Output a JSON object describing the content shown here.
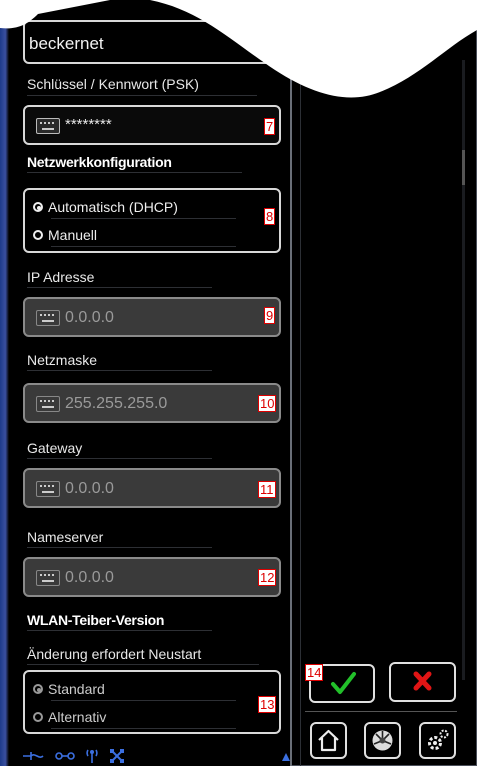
{
  "ssid": {
    "value": "beckernet"
  },
  "psk": {
    "label": "Schlüssel / Kennwort (PSK)",
    "value": "********",
    "badge": "7"
  },
  "netconfig": {
    "heading": "Netzwerkkonfiguration",
    "options": [
      "Automatisch (DHCP)",
      "Manuell"
    ],
    "selected": 0,
    "badge": "8"
  },
  "ip": {
    "label": "IP Adresse",
    "value": "0.0.0.0",
    "badge": "9"
  },
  "netmask": {
    "label": "Netzmaske",
    "value": "255.255.255.0",
    "badge": "10"
  },
  "gateway": {
    "label": "Gateway",
    "value": "0.0.0.0",
    "badge": "11"
  },
  "nameserver": {
    "label": "Nameserver",
    "value": "0.0.0.0",
    "badge": "12"
  },
  "driver": {
    "heading": "WLAN-Teiber-Version",
    "note": "Änderung erfordert Neustart",
    "options": [
      "Standard",
      "Alternativ"
    ],
    "selected": 0,
    "badge": "13"
  },
  "actions": {
    "confirm_badge": "14",
    "confirm_icon": "checkmark-icon",
    "cancel_icon": "cross-icon"
  },
  "toolbar": {
    "icons": [
      "home-icon",
      "fan-icon",
      "settings-icon"
    ]
  },
  "status_icons": [
    "ethernet-icon",
    "link-icon",
    "antenna-icon",
    "network-icon",
    "scroll-up-icon"
  ],
  "colors": {
    "confirm": "#22c02a",
    "cancel": "#e01515",
    "badge": "#dd0000"
  }
}
